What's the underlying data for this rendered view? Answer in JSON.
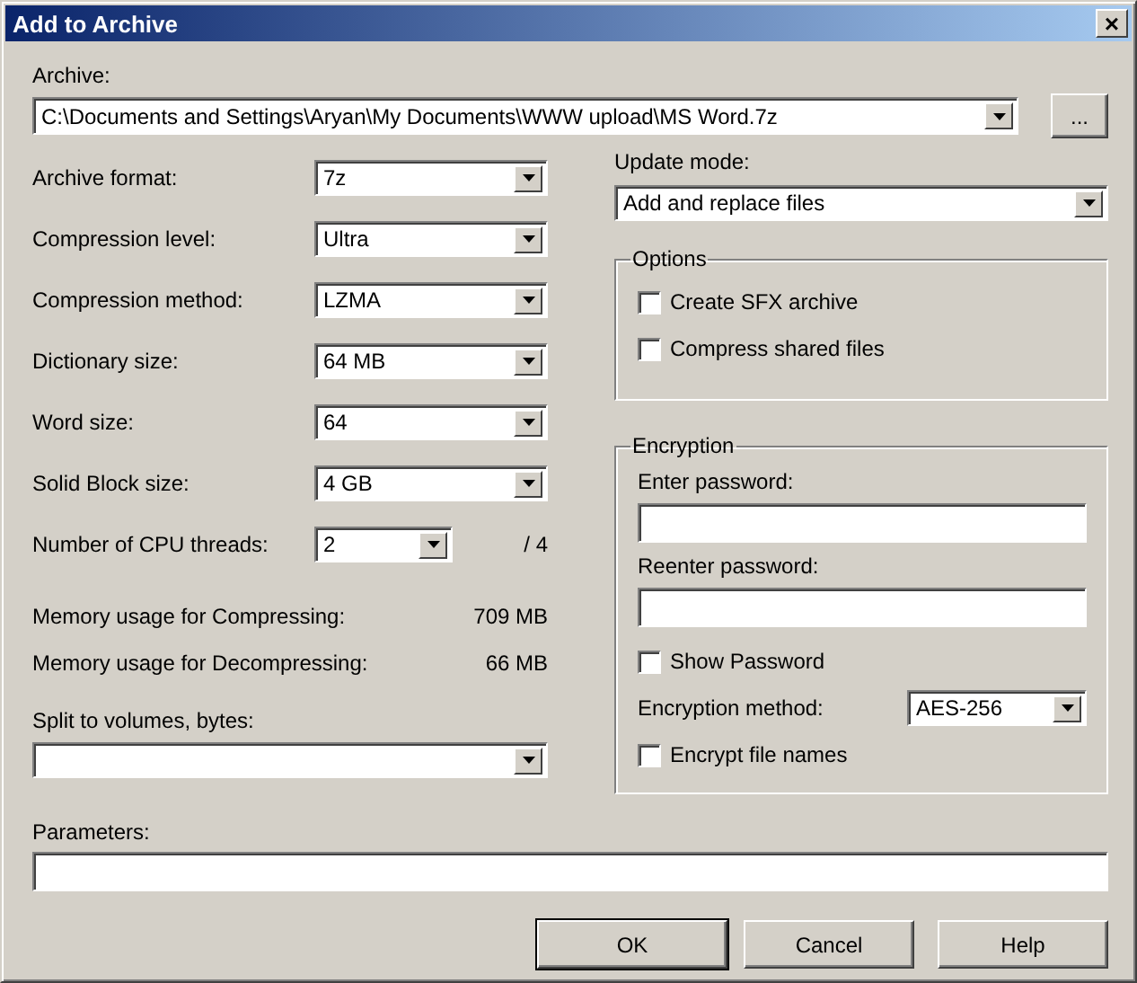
{
  "window": {
    "title": "Add to Archive",
    "close": "×"
  },
  "archive": {
    "label": "Archive:",
    "value": "C:\\Documents and Settings\\Aryan\\My Documents\\WWW upload\\MS Word.7z",
    "browse": "..."
  },
  "settings": [
    {
      "kind": "combo",
      "label": "Archive format:",
      "value": "7z"
    },
    {
      "kind": "combo",
      "label": "Compression level:",
      "value": "Ultra"
    },
    {
      "kind": "combo",
      "label": "Compression method:",
      "value": "LZMA"
    },
    {
      "kind": "combo",
      "label": "Dictionary size:",
      "value": "64 MB"
    },
    {
      "kind": "combo",
      "label": "Word size:",
      "value": "64"
    },
    {
      "kind": "combo",
      "label": "Solid Block size:",
      "value": "4 GB"
    },
    {
      "kind": "short",
      "label": "Number of CPU threads:",
      "value": "2",
      "suffix": "/ 4"
    }
  ],
  "memory": [
    {
      "label": "Memory usage for Compressing:",
      "value": "709 MB"
    },
    {
      "label": "Memory usage for Decompressing:",
      "value": "66 MB"
    }
  ],
  "split": {
    "label": "Split to volumes, bytes:"
  },
  "update_mode": {
    "label": "Update mode:",
    "value": "Add and replace files"
  },
  "options": {
    "title": "Options",
    "items": [
      {
        "label": "Create SFX archive",
        "checked": false
      },
      {
        "label": "Compress shared files",
        "checked": false
      }
    ]
  },
  "encryption": {
    "title": "Encryption",
    "fields": [
      {
        "label": "Enter password:"
      },
      {
        "label": "Reenter password:"
      }
    ],
    "show_password": {
      "label": "Show Password",
      "checked": false
    },
    "method": {
      "label": "Encryption method:",
      "value": "AES-256"
    },
    "encrypt_names": {
      "label": "Encrypt file names",
      "checked": false
    }
  },
  "parameters": {
    "label": "Parameters:"
  },
  "buttons": [
    {
      "label": "OK",
      "default": true
    },
    {
      "label": "Cancel",
      "default": false
    },
    {
      "label": "Help",
      "default": false
    }
  ]
}
